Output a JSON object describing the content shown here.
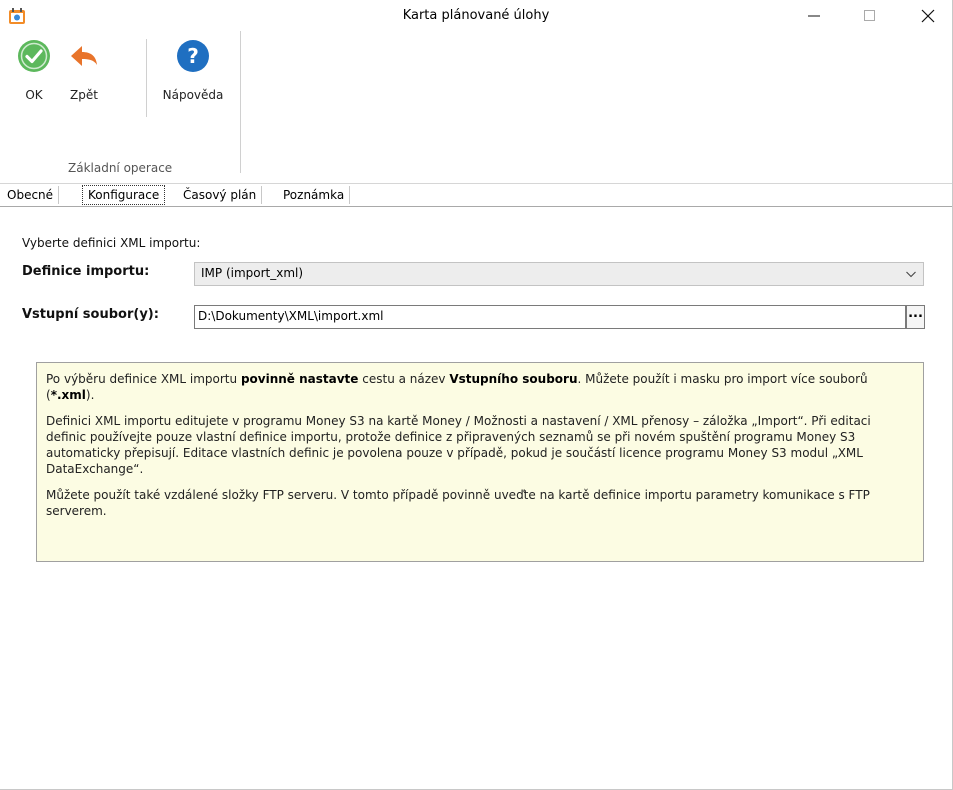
{
  "window": {
    "title": "Karta plánované úlohy",
    "minimize_glyph": "—",
    "maximize_glyph": "☐",
    "close_glyph": "✕"
  },
  "ribbon": {
    "buttons": [
      {
        "label": "OK",
        "icon": "check-circle-icon",
        "color": "#5cb85c"
      },
      {
        "label": "Zpět",
        "icon": "undo-arrow-icon",
        "color": "#e8742b"
      },
      {
        "label": "Nápověda",
        "icon": "help-circle-icon",
        "color": "#1f6fc1"
      }
    ],
    "group_label": "Základní operace"
  },
  "tabs": [
    "Obecné",
    "Konfigurace",
    "Časový plán",
    "Poznámka"
  ],
  "active_tab": "Konfigurace",
  "form": {
    "prompt": "Vyberte definici XML importu:",
    "definition_label": "Definice importu:",
    "definition_value": "IMP (import_xml)",
    "input_label": "Vstupní soubor(y):",
    "input_value": "D:\\Dokumenty\\XML\\import.xml",
    "browse_label": "..."
  },
  "info": {
    "p1_a": "Po výběru definice XML importu ",
    "p1_b": "povinně nastavte",
    "p1_c": " cestu a název ",
    "p1_d": "Vstupního souboru",
    "p1_e": ". Můžete použít i masku pro import více souborů (",
    "p1_f": "*.xml",
    "p1_g": ").",
    "p2": "Definici XML importu editujete v programu Money S3 na kartě Money / Možnosti a nastavení / XML přenosy – záložka „Import“. Při editaci definic používejte pouze vlastní definice importu, protože definice z připravených seznamů se při novém spuštění programu Money S3 automaticky přepisují. Editace vlastních definic je povolena pouze v případě, pokud je součástí licence programu Money S3 modul „XML DataExchange“.",
    "p3": "Můžete použít také vzdálené složky FTP serveru. V tomto případě povinně uveďte na kartě definice importu parametry komunikace s FTP serverem.",
    "background": "#fcfce3"
  }
}
